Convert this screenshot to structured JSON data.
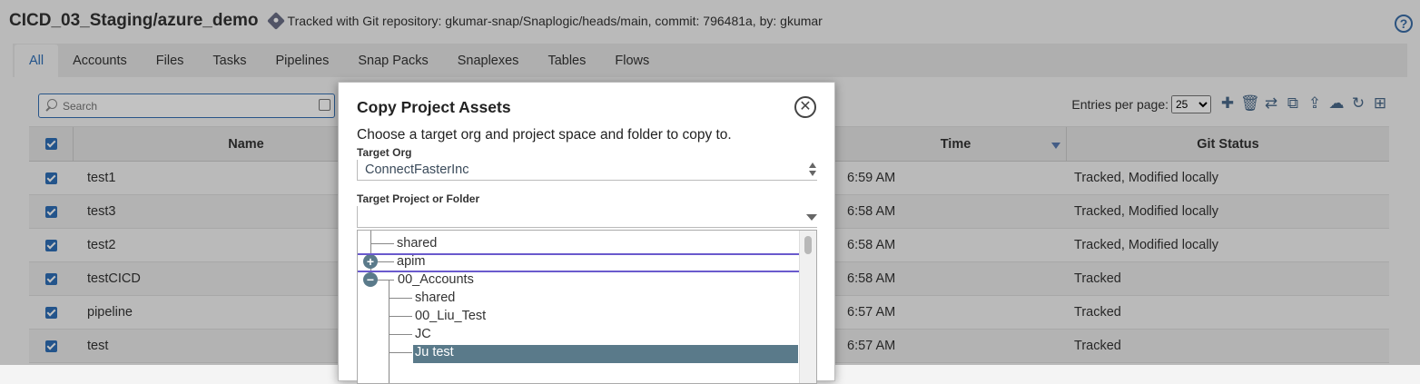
{
  "header": {
    "project_title": "CICD_03_Staging/azure_demo",
    "git_info": "Tracked with Git repository: gkumar-snap/Snaplogic/heads/main, commit: 796481a, by: gkumar",
    "help_label": "?"
  },
  "tabs": [
    {
      "label": "All"
    },
    {
      "label": "Accounts"
    },
    {
      "label": "Files"
    },
    {
      "label": "Tasks"
    },
    {
      "label": "Pipelines"
    },
    {
      "label": "Snap Packs"
    },
    {
      "label": "Snaplexes"
    },
    {
      "label": "Tables"
    },
    {
      "label": "Flows"
    }
  ],
  "toolbar": {
    "search_placeholder": "Search",
    "entries_label": "Entries per page:",
    "entries_value": "25",
    "icons": [
      "plus-icon",
      "trash-icon",
      "move-icon",
      "copy-icon",
      "upload-icon",
      "cloud-upload-icon",
      "refresh-icon",
      "grid-icon"
    ]
  },
  "table": {
    "headers": {
      "name": "Name",
      "time": "Time",
      "git_status": "Git Status"
    },
    "rows": [
      {
        "name": "test1",
        "time": "6:59 AM",
        "git_status": "Tracked, Modified locally"
      },
      {
        "name": "test3",
        "time": "6:58 AM",
        "git_status": "Tracked, Modified locally"
      },
      {
        "name": "test2",
        "time": "6:58 AM",
        "git_status": "Tracked, Modified locally"
      },
      {
        "name": "testCICD",
        "time": "6:58 AM",
        "git_status": "Tracked"
      },
      {
        "name": "pipeline",
        "time": "6:57 AM",
        "git_status": "Tracked"
      },
      {
        "name": "test",
        "time": "6:57 AM",
        "git_status": "Tracked"
      }
    ]
  },
  "modal": {
    "title": "Copy Project Assets",
    "close_label": "✕",
    "description": "Choose a target org and project space and folder to copy to.",
    "org_label": "Target Org",
    "org_value": "ConnectFasterInc",
    "folder_label": "Target Project or Folder",
    "folder_value": "",
    "tree": {
      "items": [
        "shared",
        "apim",
        "00_Accounts",
        "shared",
        "00_Liu_Test",
        "JC",
        "Ju test"
      ],
      "expand_label": "+",
      "collapse_label": "−"
    }
  },
  "colors": {
    "accent": "#2e6fb7",
    "selected_row": "#5a7a8a",
    "hover_outline": "#6a5acd"
  }
}
